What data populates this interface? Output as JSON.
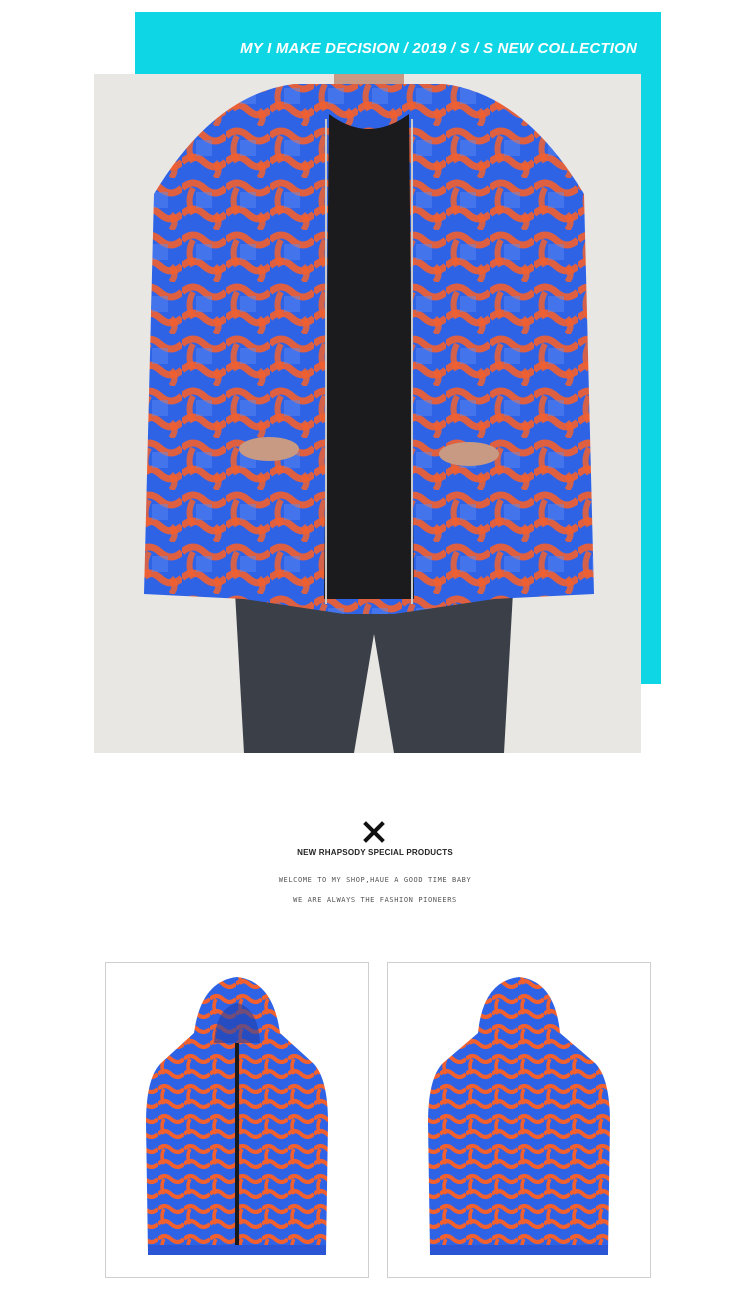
{
  "banner": {
    "text": "MY I MAKE DECISION / 2019 / S / S  NEW  COLLECTION",
    "accent_color": "#0fd6e4"
  },
  "brand": {
    "icon": "x-mark-icon",
    "title": "NEW RHAPSODY SPECIAL PRODUCTS",
    "tagline_1": "WELCOME TO MY SHOP,HAUE A GOOD TIME BABY",
    "tagline_2": "WE ARE ALWAYS THE FASHION PIONEERS"
  },
  "gallery": {
    "items": [
      "front-view",
      "back-view"
    ]
  },
  "pattern_colors": {
    "blue": "#2f63e6",
    "orange": "#f1602f"
  }
}
